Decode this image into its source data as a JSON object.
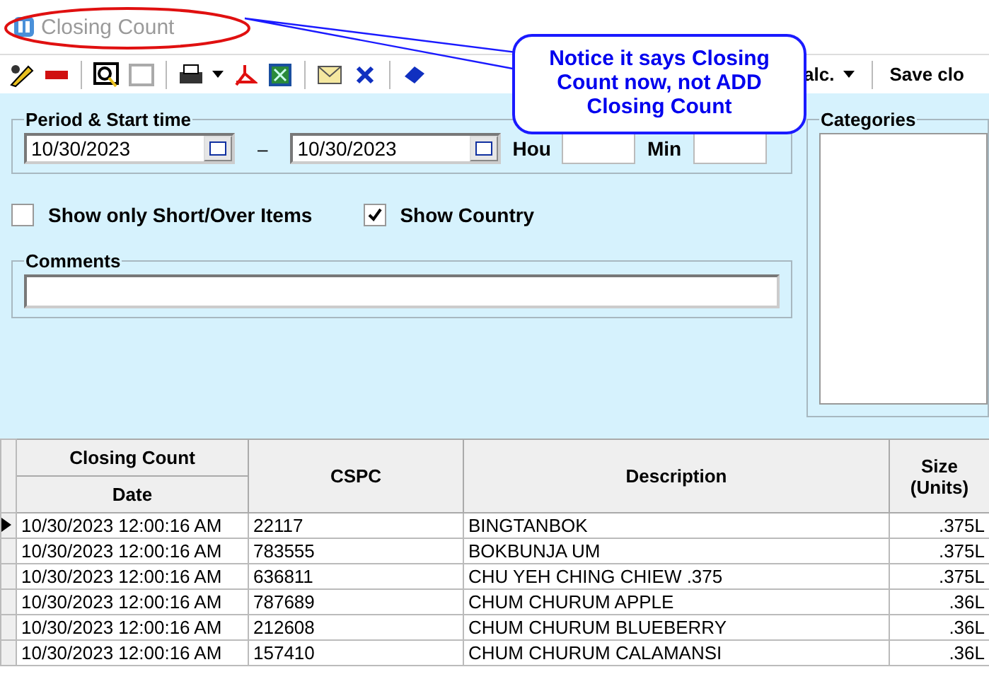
{
  "window": {
    "title": "Closing Count"
  },
  "toolbar": {
    "buttons": [
      {
        "kind": "button"
      },
      {
        "kind": "button"
      },
      {
        "kind": "separator"
      },
      {
        "kind": "button"
      },
      {
        "kind": "button"
      },
      {
        "kind": "separator"
      },
      {
        "kind": "button"
      },
      {
        "kind": "dropdown"
      },
      {
        "kind": "button"
      },
      {
        "kind": "button"
      },
      {
        "kind": "separator"
      },
      {
        "kind": "button"
      },
      {
        "kind": "button"
      },
      {
        "kind": "separator"
      },
      {
        "kind": "button"
      }
    ],
    "text_buttons": [
      {
        "label": "alc.",
        "kind": "dropdown"
      },
      {
        "label": "Save clo",
        "kind": "button"
      }
    ]
  },
  "period": {
    "legend": "Period & Start time",
    "from": "10/30/2023",
    "to": "10/30/2023",
    "separator": "–",
    "hour_label": "Hou",
    "min_label": "Min"
  },
  "options": [
    {
      "label": "Show only Short/Over Items",
      "checked": false
    },
    {
      "label": "Show Country",
      "checked": true
    }
  ],
  "comments": {
    "legend": "Comments"
  },
  "categories": {
    "legend": "Categories"
  },
  "callout": {
    "text": "Notice it says Closing Count now, not ADD Closing Count"
  },
  "grid": {
    "group_header": "Closing Count",
    "columns": [
      "Date",
      "CSPC",
      "Description",
      "Size (Units)"
    ],
    "rows": [
      {
        "date": "10/30/2023 12:00:16 AM",
        "cspc": "22117",
        "description": "BINGTANBOK",
        "size": ".375L",
        "selected": true
      },
      {
        "date": "10/30/2023 12:00:16 AM",
        "cspc": "783555",
        "description": "BOKBUNJA UM",
        "size": ".375L",
        "selected": false
      },
      {
        "date": "10/30/2023 12:00:16 AM",
        "cspc": "636811",
        "description": "CHU YEH CHING CHIEW .375",
        "size": ".375L",
        "selected": false
      },
      {
        "date": "10/30/2023 12:00:16 AM",
        "cspc": "787689",
        "description": "CHUM CHURUM APPLE",
        "size": ".36L",
        "selected": false
      },
      {
        "date": "10/30/2023 12:00:16 AM",
        "cspc": "212608",
        "description": "CHUM CHURUM BLUEBERRY",
        "size": ".36L",
        "selected": false
      },
      {
        "date": "10/30/2023 12:00:16 AM",
        "cspc": "157410",
        "description": "CHUM CHURUM CALAMANSI",
        "size": ".36L",
        "selected": false
      }
    ]
  }
}
